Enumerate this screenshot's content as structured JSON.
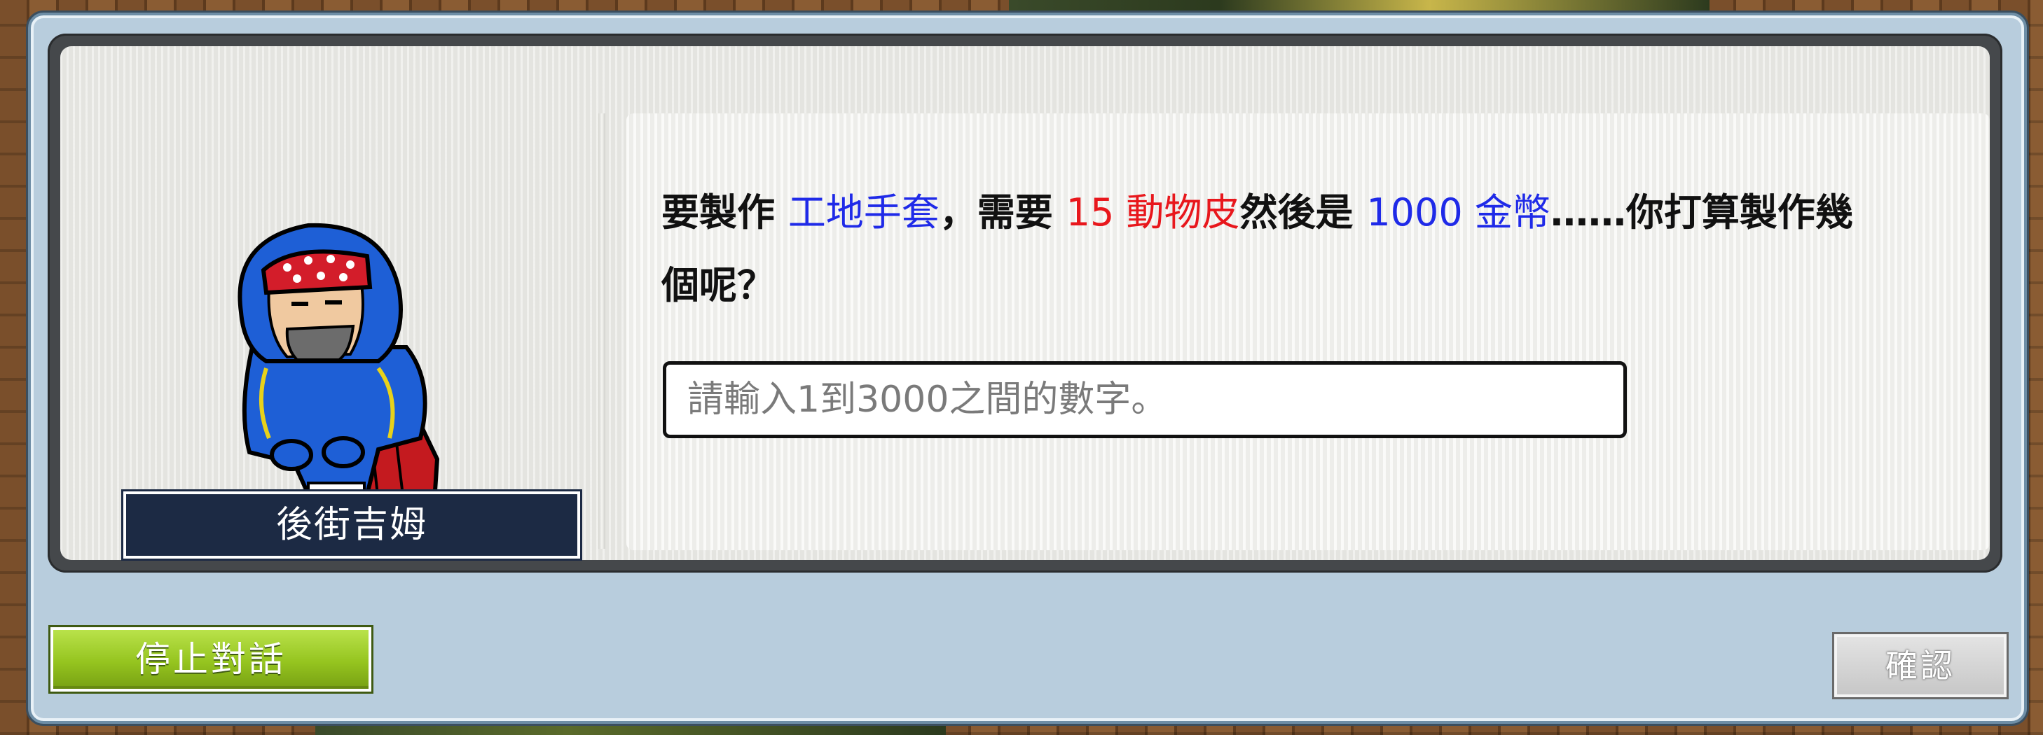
{
  "npc": {
    "name": "後街吉姆",
    "portrait_icon": "hooded-thief-npc-icon"
  },
  "message": {
    "segments": [
      {
        "text": "要製作 ",
        "color": "#111111"
      },
      {
        "text": "工地手套",
        "color": "#1f2ae8"
      },
      {
        "text": "，需要 ",
        "color": "#111111"
      },
      {
        "text": "15 動物皮",
        "color": "#e8171c"
      },
      {
        "text": "然後是 ",
        "color": "#111111"
      },
      {
        "text": "1000 金幣",
        "color": "#1f2ae8"
      },
      {
        "text": "……你打算製作幾個呢？",
        "color": "#111111"
      }
    ]
  },
  "quantity_input": {
    "value": "",
    "placeholder": "請輸入1到3000之間的數字。"
  },
  "buttons": {
    "stop": "停止對話",
    "confirm": "確認"
  },
  "colors": {
    "highlight_blue": "#1f2ae8",
    "highlight_red": "#e8171c",
    "stop_button_green": "#95c41f",
    "name_plate": "#1c2a44"
  }
}
